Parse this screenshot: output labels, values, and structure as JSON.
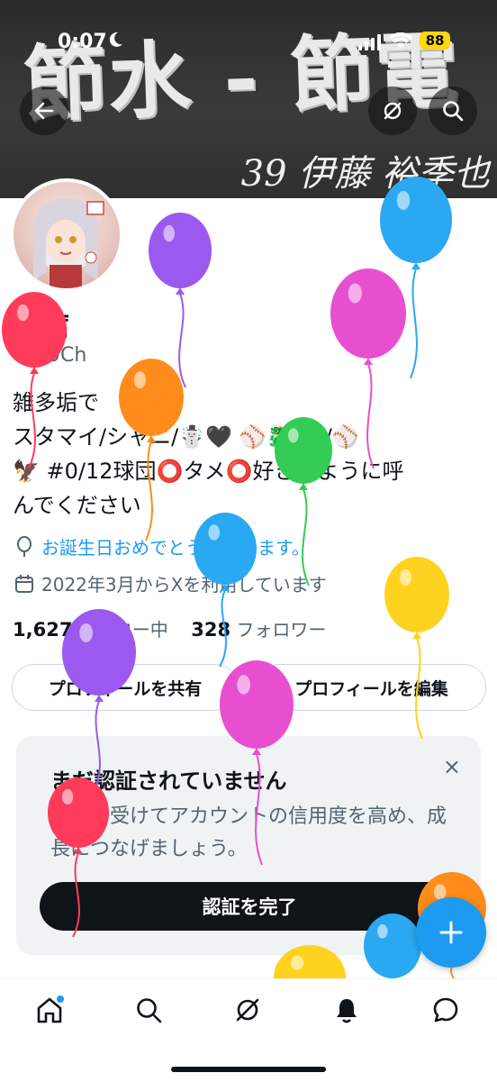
{
  "status_bar": {
    "time": "0:07",
    "battery": "88"
  },
  "banner": {
    "calligraphy": "節水 - 節電",
    "subtitle": "39 伊藤 裕季也"
  },
  "profile": {
    "name": "豆腐",
    "handle": "@19Ch",
    "bio_lines": [
      "雑多垢で",
      "スタマイ/シャニ/☃️🖤 ⚾️🐉#2/⚾️",
      "🦅 #0/12球団⭕タメ⭕好きなように呼",
      "んでください"
    ],
    "birthday_text": "お誕生日おめでとうございます。",
    "joined_text": "2022年3月からXを利用しています",
    "following_count": "1,627",
    "following_label": "フォロー中",
    "followers_count": "328",
    "followers_label": "フォロワー"
  },
  "buttons": {
    "share_profile": "プロフィールを共有",
    "edit_profile": "プロフィールを編集"
  },
  "verification_card": {
    "title": "まだ認証されていません",
    "body": "認証を受けてアカウントの信用度を高め、成長につなげましょう。",
    "button": "認証を完了",
    "close": "×"
  },
  "tabs": [
    "home-icon",
    "search-icon",
    "grok-icon",
    "notifications-icon",
    "messages-icon"
  ],
  "colors": {
    "accent": "#1d9bf0",
    "text": "#0f1419",
    "muted": "#536471",
    "card_bg": "#eff3f4"
  },
  "balloons": [
    {
      "color": "#ff3b5c",
      "name": "red"
    },
    {
      "color": "#9b59f0",
      "name": "purple"
    },
    {
      "color": "#ff8c1a",
      "name": "orange"
    },
    {
      "color": "#e84fd0",
      "name": "pink"
    },
    {
      "color": "#2aa8f2",
      "name": "blue"
    },
    {
      "color": "#33cc55",
      "name": "green"
    },
    {
      "color": "#ffd21f",
      "name": "yellow"
    }
  ]
}
